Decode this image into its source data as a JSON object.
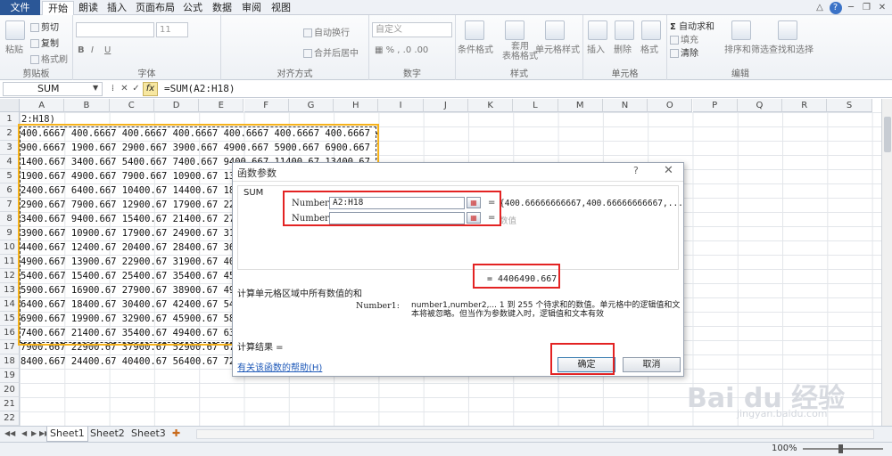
{
  "menu": {
    "file": "文件",
    "tabs": [
      "开始",
      "朗读",
      "插入",
      "页面布局",
      "公式",
      "数据",
      "审阅",
      "视图"
    ]
  },
  "ribbon": {
    "clipboard": {
      "paste": "粘贴",
      "cut": "剪切",
      "copy": "复制",
      "format_painter": "格式刷",
      "label": "剪贴板"
    },
    "font": {
      "size": "11",
      "label": "字体",
      "bold": "B",
      "italic": "I",
      "underline": "U"
    },
    "alignment": {
      "wrap": "自动换行",
      "merge": "合并后居中",
      "label": "对齐方式"
    },
    "number": {
      "format": "自定义",
      "label": "数字"
    },
    "styles": {
      "conditional": "条件格式",
      "table": "套用\n表格格式",
      "cell": "单元格样式",
      "label": "样式"
    },
    "cells": {
      "insert": "插入",
      "delete": "删除",
      "format": "格式",
      "label": "单元格"
    },
    "editing": {
      "autosum": "自动求和",
      "fill": "填充",
      "clear": "清除",
      "sort": "排序和筛选",
      "find": "查找和选择",
      "label": "编辑"
    }
  },
  "formula_bar": {
    "name_box": "SUM",
    "formula": "=SUM(A2:H18)"
  },
  "columns": [
    "A",
    "B",
    "C",
    "D",
    "E",
    "F",
    "G",
    "H",
    "I",
    "J",
    "K",
    "L",
    "M",
    "N",
    "O",
    "P",
    "Q",
    "R",
    "S"
  ],
  "rows": [
    "1",
    "2",
    "3",
    "4",
    "5",
    "6",
    "7",
    "8",
    "9",
    "10",
    "11",
    "12",
    "13",
    "14",
    "15",
    "16",
    "17",
    "18",
    "19",
    "20",
    "21",
    "22"
  ],
  "a1_text": "2:H18)",
  "cell_rows": [
    "400.6667 400.6667 400.6667 400.6667 400.6667 400.6667 400.6667 400.6667",
    "900.6667 1900.667 2900.667 3900.667 4900.667 5900.667 6900.667 7900.667",
    "1400.667 3400.667 5400.667 7400.667 9400.667 11400.67 13400.67 15400.67",
    "1900.667 4900.667 7900.667 10900.67 13900.6",
    "2400.667 6400.667 10400.67 14400.67 18400.6",
    "2900.667 7900.667 12900.67 17900.67 22900.6",
    "3400.667 9400.667 15400.67 21400.67 27400.6",
    "3900.667 10900.67 17900.67 24900.67 31900.6",
    "4400.667 12400.67 20400.67 28400.67 36400.6",
    "4900.667 13900.67 22900.67 31900.67 40900.6",
    "5400.667 15400.67 25400.67 35400.67 45400.6",
    "5900.667 16900.67 27900.67 38900.67 49900.6",
    "6400.667 18400.67 30400.67 42400.67 54400.6",
    "6900.667 19900.67 32900.67 45900.67 58900.6",
    "7400.667 21400.67 35400.67 49400.67 63400.6",
    "7900.667 22900.67 37900.67 52900.67 67900.6",
    "8400.667 24400.67 40400.67 56400.67 72400.6"
  ],
  "sheets": [
    "Sheet1",
    "Sheet2",
    "Sheet3"
  ],
  "zoom": "100%",
  "dialog": {
    "title": "函数参数",
    "help": "?",
    "close": "✕",
    "function_name": "SUM",
    "arg1_label": "Number1",
    "arg1_value": "A2:H18",
    "arg1_result": "{400.66666666667,400.66666666667,...",
    "arg2_label": "Number2",
    "arg2_value": "",
    "arg2_result": "数值",
    "equals": "=",
    "result": "= 4406490.667",
    "description": "计算单元格区域中所有数值的和",
    "arg_desc_name": "Number1:",
    "arg_desc_text": "number1,number2,...  1 到 255 个待求和的数值。单元格中的逻辑值和文本将被忽略。但当作为参数键入时，逻辑值和文本有效",
    "calc_result": "计算结果 =",
    "help_link": "有关该函数的帮助(H)",
    "ok": "确定",
    "cancel": "取消"
  },
  "watermark": "Bai du 经验",
  "watermark_sub": "jingyan.baidu.com"
}
